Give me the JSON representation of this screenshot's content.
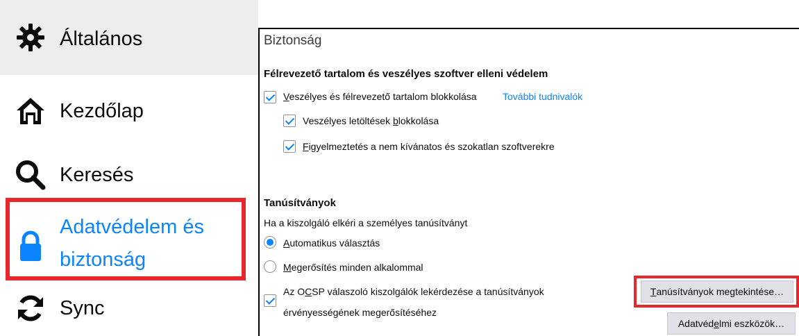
{
  "sidebar": {
    "items": [
      {
        "label": "Általános",
        "icon": "gear-icon"
      },
      {
        "label": "Kezdőlap",
        "icon": "home-icon"
      },
      {
        "label": "Keresés",
        "icon": "search-icon"
      },
      {
        "label_line1": "Adatvédelem és",
        "label_line2": "biztonság",
        "icon": "lock-icon"
      },
      {
        "label": "Sync",
        "icon": "sync-icon"
      }
    ]
  },
  "panel": {
    "title": "Biztonság",
    "deceptive": {
      "heading": "Félrevezető tartalom és veszélyes szoftver elleni védelem",
      "block_dangerous": {
        "pre": "",
        "key": "V",
        "post": "eszélyes és félrevezető tartalom blokkolása",
        "checked": true
      },
      "learn_more": "További tudnivalók",
      "block_downloads": {
        "pre": "Veszélyes letöltések ",
        "key": "b",
        "post": "lokkolása",
        "checked": true
      },
      "warn_unwanted": {
        "pre": "",
        "key": "F",
        "post": "igyelmeztetés a nem kívánatos és szokatlan szoftverekre",
        "checked": true
      }
    },
    "certificates": {
      "heading": "Tanúsítványok",
      "prompt": "Ha a kiszolgáló elkéri a személyes tanúsítványt",
      "auto_select": {
        "pre": "",
        "key": "A",
        "post": "utomatikus választás",
        "selected": true
      },
      "ask_every": {
        "pre": "",
        "key": "M",
        "post": "egerősítés minden alkalommal",
        "selected": false
      },
      "ocsp_line1_pre": "Az O",
      "ocsp_line1_key": "C",
      "ocsp_line1_post": "SP válaszoló kiszolgálók lekérdezése a tanúsítványok",
      "ocsp_line2": "érvényességének megerősítéséhez",
      "ocsp_checked": true,
      "view_certs_button": {
        "pre": "",
        "key": "T",
        "post": "anúsítványok megtekintése…"
      },
      "security_devices_button": {
        "pre": "Adatvéd",
        "key": "e",
        "post": "lmi eszközök…"
      }
    }
  },
  "colors": {
    "accent": "#0a84ff",
    "highlight": "#e8262b"
  }
}
